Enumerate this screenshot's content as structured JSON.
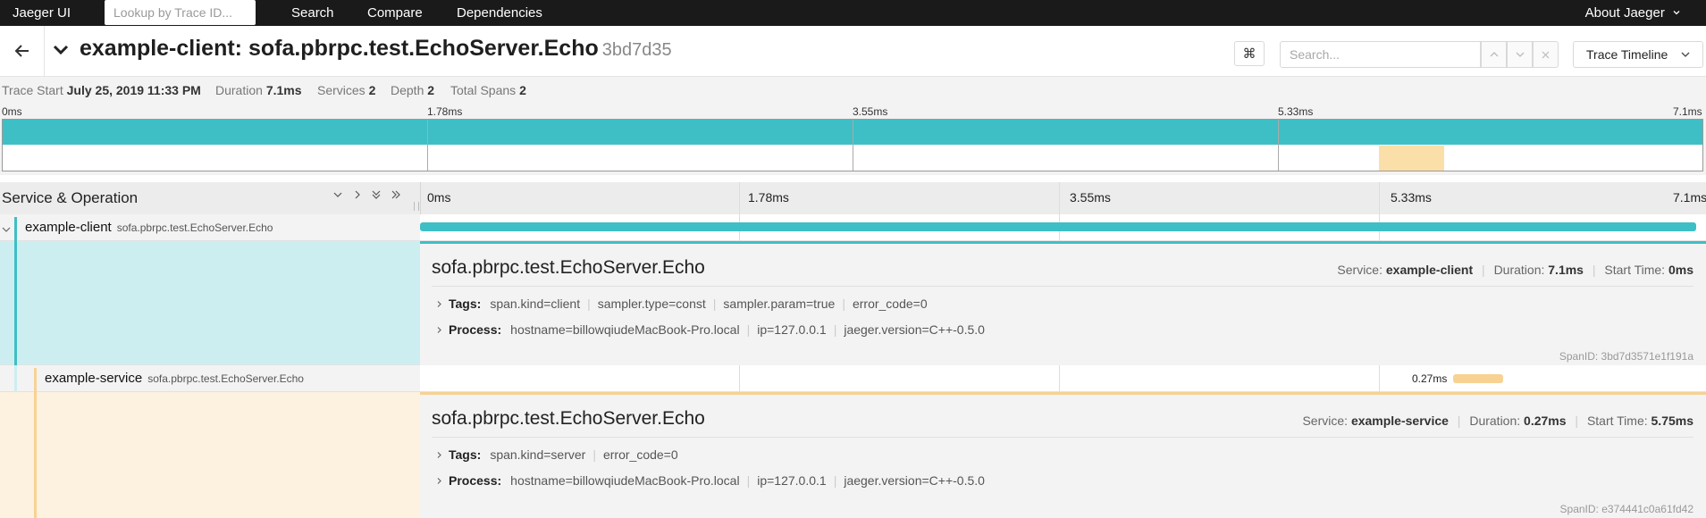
{
  "topnav": {
    "brand": "Jaeger UI",
    "lookup_placeholder": "Lookup by Trace ID...",
    "items": [
      "Search",
      "Compare",
      "Dependencies"
    ],
    "about": "About Jaeger"
  },
  "trace": {
    "title": "example-client: sofa.pbrpc.test.EchoServer.Echo",
    "trace_id": "3bd7d35",
    "search_placeholder": "Search...",
    "view_select": "Trace Timeline",
    "keyboard_icon": "⌘"
  },
  "summary": {
    "trace_start_label": "Trace Start",
    "trace_start": "July 25, 2019 11:33 PM",
    "duration_label": "Duration",
    "duration": "7.1ms",
    "services_label": "Services",
    "services": "2",
    "depth_label": "Depth",
    "depth": "2",
    "total_spans_label": "Total Spans",
    "total_spans": "2"
  },
  "minimap": {
    "ticks": [
      "0ms",
      "1.78ms",
      "3.55ms",
      "5.33ms",
      "7.1ms"
    ]
  },
  "timeline": {
    "column_label": "Service & Operation",
    "ticks": [
      "0ms",
      "1.78ms",
      "3.55ms",
      "5.33ms",
      "7.1ms"
    ]
  },
  "spans": [
    {
      "service": "example-client",
      "operation": "sofa.pbrpc.test.EchoServer.Echo",
      "detail": {
        "title": "sofa.pbrpc.test.EchoServer.Echo",
        "service_label": "Service:",
        "service": "example-client",
        "duration_label": "Duration:",
        "duration": "7.1ms",
        "start_label": "Start Time:",
        "start": "0ms",
        "tags_label": "Tags:",
        "tags": [
          "span.kind=client",
          "sampler.type=const",
          "sampler.param=true",
          "error_code=0"
        ],
        "process_label": "Process:",
        "process": [
          "hostname=billowqiudeMacBook-Pro.local",
          "ip=127.0.0.1",
          "jaeger.version=C++-0.5.0"
        ],
        "spanid_label": "SpanID:",
        "spanid": "3bd7d3571e1f191a"
      }
    },
    {
      "service": "example-service",
      "operation": "sofa.pbrpc.test.EchoServer.Echo",
      "bar_label": "0.27ms",
      "detail": {
        "title": "sofa.pbrpc.test.EchoServer.Echo",
        "service_label": "Service:",
        "service": "example-service",
        "duration_label": "Duration:",
        "duration": "0.27ms",
        "start_label": "Start Time:",
        "start": "5.75ms",
        "tags_label": "Tags:",
        "tags": [
          "span.kind=server",
          "error_code=0"
        ],
        "process_label": "Process:",
        "process": [
          "hostname=billowqiudeMacBook-Pro.local",
          "ip=127.0.0.1",
          "jaeger.version=C++-0.5.0"
        ],
        "spanid_label": "SpanID:",
        "spanid": "e374441c0a61fd42"
      }
    }
  ],
  "colors": {
    "client": "#3ebfc5",
    "service": "#f8d293"
  }
}
